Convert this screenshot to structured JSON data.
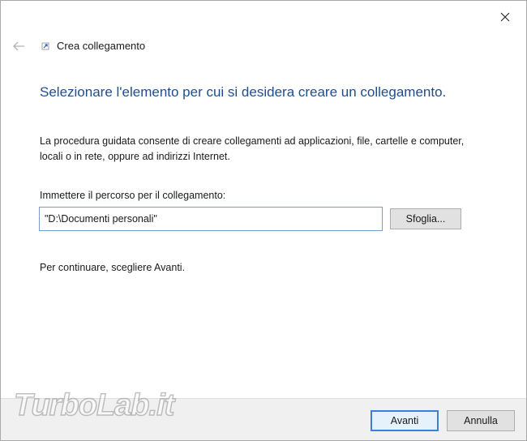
{
  "window": {
    "title": "Crea collegamento",
    "close_icon": "close-icon",
    "back_icon": "back-arrow-icon"
  },
  "main": {
    "heading": "Selezionare l'elemento per cui si desidera creare un collegamento.",
    "description": "La procedura guidata consente di creare collegamenti ad applicazioni, file, cartelle e computer, locali o in rete, oppure ad indirizzi Internet.",
    "path_label": "Immettere il percorso per il collegamento:",
    "path_value": "\"D:\\Documenti personali\"",
    "browse_label": "Sfoglia...",
    "continue_text": "Per continuare, scegliere Avanti."
  },
  "footer": {
    "next_label": "Avanti",
    "cancel_label": "Annulla"
  },
  "watermark": {
    "text": "TurboLab.it"
  },
  "colors": {
    "heading": "#1e4e8c",
    "footer_bg": "#f0f0f0",
    "default_button_border": "#3c7fd6"
  }
}
